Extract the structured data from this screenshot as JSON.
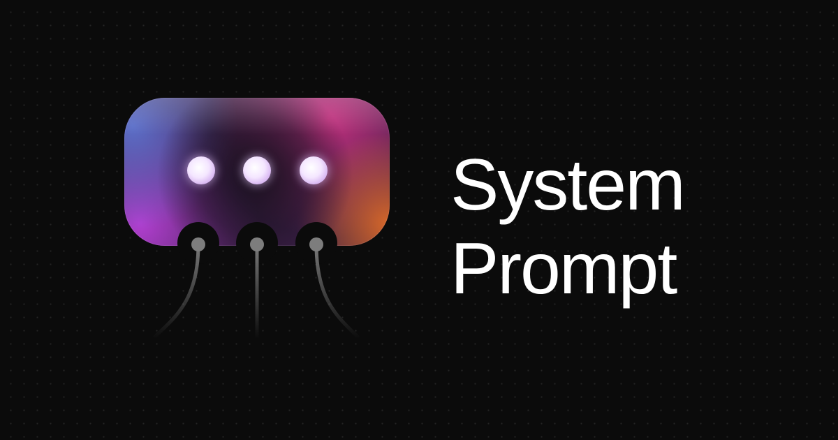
{
  "title": {
    "line1": "System",
    "line2": "Prompt"
  },
  "logo": {
    "icon": "chat-bubble-with-cables-icon",
    "dots": 3,
    "colors": {
      "blue": "#5b6fc9",
      "purple": "#a23bc4",
      "magenta": "#c2307e",
      "orange": "#d4662a",
      "dot_glow": "#f2e2ff",
      "cable": "#6f6f6f"
    }
  },
  "colors": {
    "background": "#0b0b0b",
    "text": "#ffffff"
  }
}
